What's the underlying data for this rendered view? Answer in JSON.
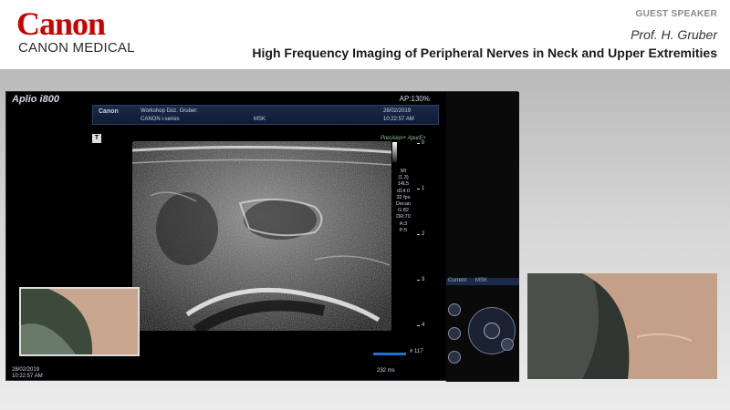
{
  "header": {
    "logo_text": "Canon",
    "logo_subtitle": "CANON MEDICAL",
    "guest_label": "GUEST SPEAKER",
    "speaker": "Prof. H. Gruber",
    "talk_title": "High Frequency Imaging of Peripheral Nerves in Neck and Upper Extremities"
  },
  "ultrasound": {
    "brand": "Aplio i800",
    "ap": "AP:130%",
    "info_logo": "Canon",
    "info_line1": "Workshop Doz. Gruber:",
    "info_line2": "CANON i-series",
    "info_line3": "MSK",
    "info_date": "28/02/2019",
    "info_time": "10:22:57 AM",
    "precision_label": "Precision+  ApurE+",
    "tmark": "T",
    "params": [
      "MI",
      "(1.3)",
      "14L5",
      "d14.0",
      "32 fps",
      "Decan",
      "G:82",
      "DR:70",
      "A:3",
      "P:5"
    ],
    "depth_labels": [
      "0",
      "1",
      "2",
      "3",
      "4"
    ],
    "bottom_date": "28/02/2019",
    "bottom_time": "10:22:57 AM",
    "slider_value": "# 117",
    "status_text": "232 ms",
    "panel_current": "Current",
    "panel_preset": "MSK",
    "icons": [
      "menu-wheel-icon"
    ]
  },
  "colors": {
    "brand_red": "#cc0000",
    "slider_blue": "#1e6fd8"
  }
}
